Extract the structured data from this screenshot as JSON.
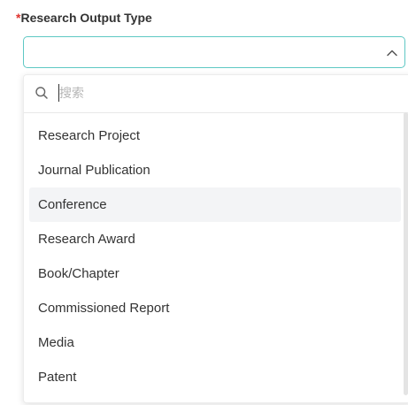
{
  "field": {
    "required_marker": "*",
    "label": "Research Output Type",
    "value": ""
  },
  "search": {
    "placeholder": "搜索",
    "value": ""
  },
  "options": [
    "Research Project",
    "Journal Publication",
    "Conference",
    "Research Award",
    "Book/Chapter",
    "Commissioned Report",
    "Media",
    "Patent"
  ],
  "highlighted_option": "Conference",
  "colors": {
    "required": "#e0332e",
    "focus_border": "#5ec8c4",
    "hover_bg": "#f3f4f6"
  },
  "icons": {
    "select_toggle": "chevron-up-icon",
    "search": "search-icon"
  }
}
